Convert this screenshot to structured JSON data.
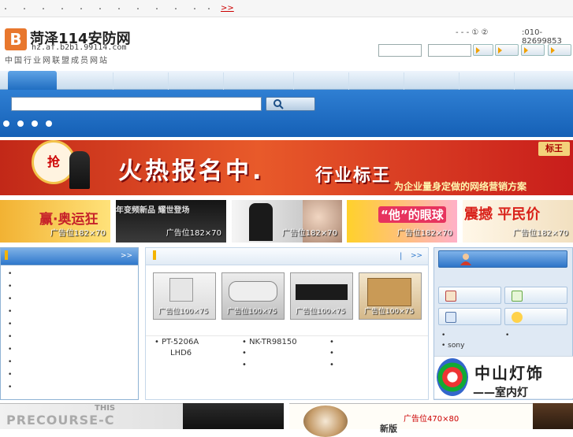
{
  "topbar": {
    "link": ">>"
  },
  "logo": {
    "mark": "B",
    "title": "菏泽114安防网",
    "url": "hz.af.b2b1.99114.com",
    "subtitle": "中国行业网联盟成员网站"
  },
  "header": {
    "links": "- - - ① ②",
    "phone": ":010-82699853"
  },
  "search": {
    "placeholder": ""
  },
  "banner": {
    "badge": "抢",
    "headline": "火热报名中.",
    "title": "行业标王",
    "slogan": "为企业量身定做的网络营销方案",
    "tag": "标王"
  },
  "ads": [
    {
      "text": "赢·奥运狂",
      "label": "广告位182×70"
    },
    {
      "text": "年变频新品 耀世登场",
      "label": "广告位182×70"
    },
    {
      "text": "",
      "label": "广告位182×70"
    },
    {
      "text": "“他”的眼球",
      "label": "广告位182×70"
    },
    {
      "text": "震撼 平民价",
      "label": "广告位182×70"
    }
  ],
  "left_panel": {
    "more": ">>",
    "items": [
      "•",
      "•",
      "•",
      "•",
      "•",
      "•",
      "•",
      "•",
      "•",
      "•"
    ]
  },
  "mid_panel": {
    "more": ">>",
    "sep": "|"
  },
  "products": [
    {
      "label": "广告位100×75"
    },
    {
      "label": "广告位100×75"
    },
    {
      "label": "广告位100×75"
    },
    {
      "label": "广告位100×75"
    }
  ],
  "mid_items": {
    "col1": [
      "• PT-5206A",
      "LHD6"
    ],
    "col2": [
      "• NK-TR98150",
      "•",
      "•"
    ],
    "col3": [
      "•",
      "•",
      "•"
    ]
  },
  "right_panel": {
    "sony": "• sony",
    "bullets": [
      "•",
      "•"
    ]
  },
  "right_ad": {
    "text1": "中山灯饰",
    "text2": "——室内灯"
  },
  "bottom": {
    "left_text": "PRECOURSE-C",
    "left_small": "THIS",
    "right_label": "广告位470×80",
    "right_new": "新版"
  }
}
